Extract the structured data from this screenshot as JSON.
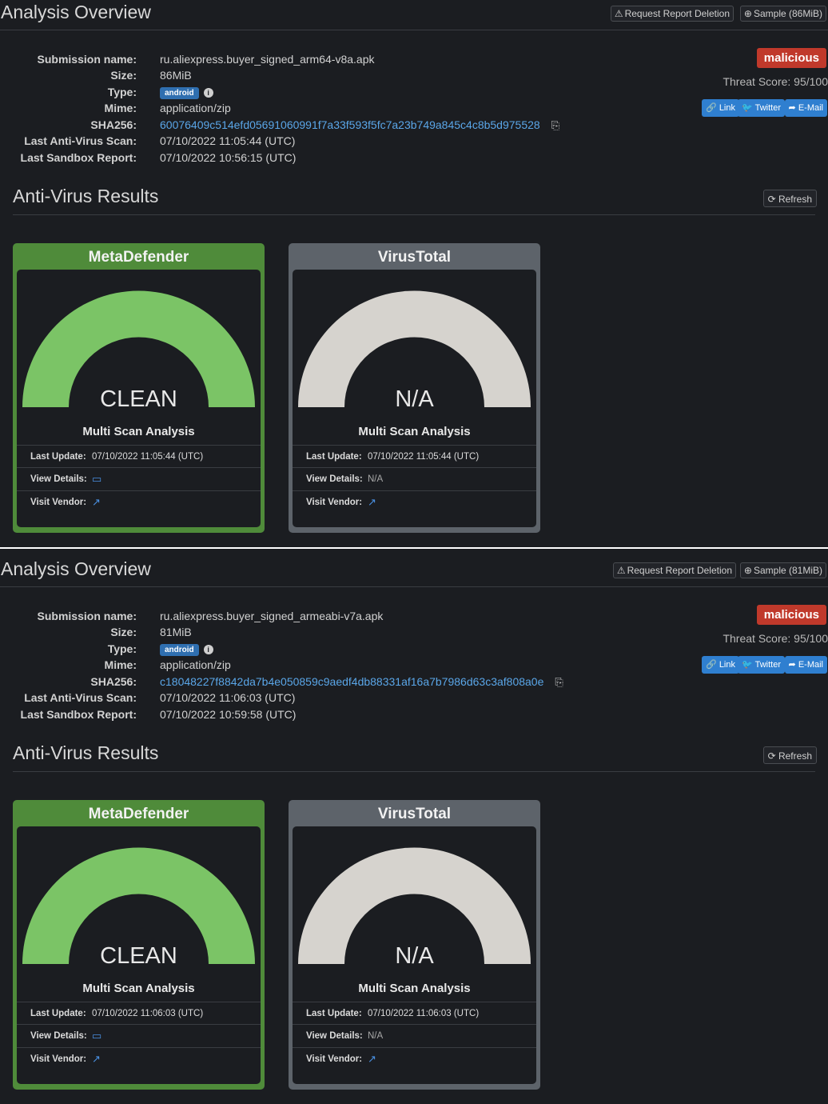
{
  "reports": [
    {
      "header": {
        "title": "Analysis Overview",
        "request_deletion_label": "Request Report Deletion",
        "sample_label": "Sample (86MiB)"
      },
      "details": {
        "submission_name_label": "Submission name:",
        "submission_name": "ru.aliexpress.buyer_signed_arm64-v8a.apk",
        "size_label": "Size:",
        "size": "86MiB",
        "type_label": "Type:",
        "type": "android",
        "mime_label": "Mime:",
        "mime": "application/zip",
        "sha256_label": "SHA256:",
        "sha256": "60076409c514efd05691060991f7a33f593f5fc7a23b749a845c4c8b5d975528",
        "last_av_scan_label": "Last Anti-Virus Scan:",
        "last_av_scan": "07/10/2022 11:05:44 (UTC)",
        "last_sandbox_label": "Last Sandbox Report:",
        "last_sandbox": "07/10/2022 10:56:15 (UTC)"
      },
      "verdict": {
        "label": "malicious",
        "threat_score": "Threat Score: 95/100",
        "color": "#c0392b"
      },
      "share": {
        "link": "Link",
        "twitter": "Twitter",
        "email": "E-Mail"
      },
      "av": {
        "title": "Anti-Virus Results",
        "refresh_label": "Refresh",
        "cards": [
          {
            "vendor": "MetaDefender",
            "result": "CLEAN",
            "caption": "Multi Scan Analysis",
            "last_update_label": "Last Update:",
            "last_update": "07/10/2022 11:05:44 (UTC)",
            "view_details_label": "View Details:",
            "view_details": "",
            "visit_vendor_label": "Visit Vendor:",
            "gauge_color": "#7bc466",
            "header_color": "#4f8b3a"
          },
          {
            "vendor": "VirusTotal",
            "result": "N/A",
            "caption": "Multi Scan Analysis",
            "last_update_label": "Last Update:",
            "last_update": "07/10/2022 11:05:44 (UTC)",
            "view_details_label": "View Details:",
            "view_details": "N/A",
            "visit_vendor_label": "Visit Vendor:",
            "gauge_color": "#d6d3ce",
            "header_color": "#5d636a"
          }
        ]
      }
    },
    {
      "header": {
        "title": "Analysis Overview",
        "request_deletion_label": "Request Report Deletion",
        "sample_label": "Sample (81MiB)"
      },
      "details": {
        "submission_name_label": "Submission name:",
        "submission_name": "ru.aliexpress.buyer_signed_armeabi-v7a.apk",
        "size_label": "Size:",
        "size": "81MiB",
        "type_label": "Type:",
        "type": "android",
        "mime_label": "Mime:",
        "mime": "application/zip",
        "sha256_label": "SHA256:",
        "sha256": "c18048227f8842da7b4e050859c9aedf4db88331af16a7b7986d63c3af808a0e",
        "last_av_scan_label": "Last Anti-Virus Scan:",
        "last_av_scan": "07/10/2022 11:06:03 (UTC)",
        "last_sandbox_label": "Last Sandbox Report:",
        "last_sandbox": "07/10/2022 10:59:58 (UTC)"
      },
      "verdict": {
        "label": "malicious",
        "threat_score": "Threat Score: 95/100",
        "color": "#c0392b"
      },
      "share": {
        "link": "Link",
        "twitter": "Twitter",
        "email": "E-Mail"
      },
      "av": {
        "title": "Anti-Virus Results",
        "refresh_label": "Refresh",
        "cards": [
          {
            "vendor": "MetaDefender",
            "result": "CLEAN",
            "caption": "Multi Scan Analysis",
            "last_update_label": "Last Update:",
            "last_update": "07/10/2022 11:06:03 (UTC)",
            "view_details_label": "View Details:",
            "view_details": "",
            "visit_vendor_label": "Visit Vendor:",
            "gauge_color": "#7bc466",
            "header_color": "#4f8b3a"
          },
          {
            "vendor": "VirusTotal",
            "result": "N/A",
            "caption": "Multi Scan Analysis",
            "last_update_label": "Last Update:",
            "last_update": "07/10/2022 11:06:03 (UTC)",
            "view_details_label": "View Details:",
            "view_details": "N/A",
            "visit_vendor_label": "Visit Vendor:",
            "gauge_color": "#d6d3ce",
            "header_color": "#5d636a"
          }
        ]
      }
    }
  ]
}
